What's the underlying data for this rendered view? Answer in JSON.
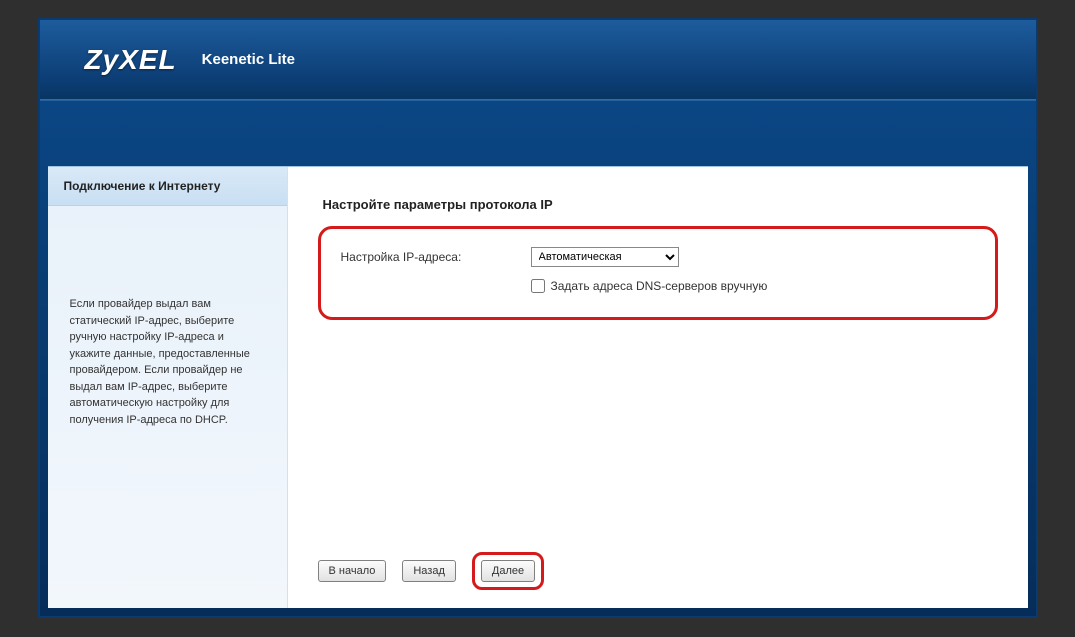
{
  "brand": "ZyXEL",
  "product": "Keenetic Lite",
  "sidebar": {
    "tab_title": "Подключение к Интернету",
    "help_text": "Если провайдер выдал вам статический IP-адрес, выберите ручную настройку IP-адреса и укажите данные, предоставленные провайдером. Если провайдер не выдал вам IP-адрес, выберите автоматическую настройку для получения IP-адреса по DHCP."
  },
  "main": {
    "heading": "Настройте параметры протокола IP",
    "ip_label": "Настройка IP-адреса:",
    "ip_select_value": "Автоматическая",
    "dns_checkbox_label": "Задать адреса DNS-серверов вручную"
  },
  "buttons": {
    "restart": "В начало",
    "back": "Назад",
    "next": "Далее"
  }
}
